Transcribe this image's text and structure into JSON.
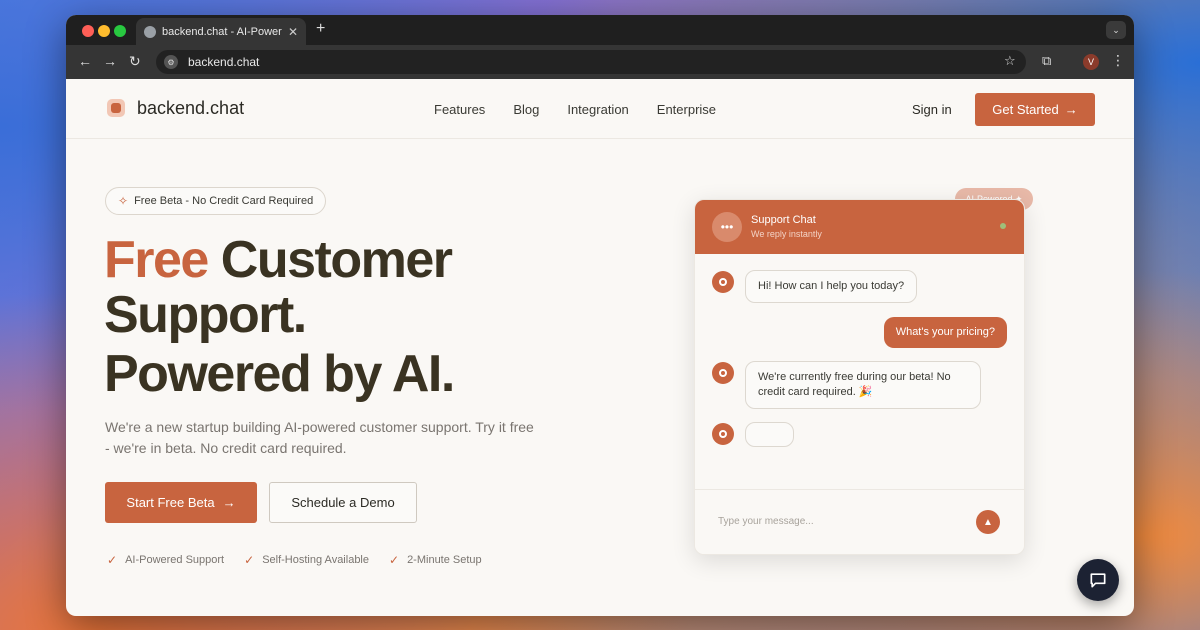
{
  "browser": {
    "tab_title": "backend.chat - AI-Powered C",
    "tab_close": "✕",
    "new_tab": "+",
    "url": "backend.chat",
    "profile_initial": "V"
  },
  "header": {
    "logo_text": "backend.chat",
    "nav": [
      "Features",
      "Blog",
      "Integration",
      "Enterprise"
    ],
    "sign_in": "Sign in",
    "get_started": "Get Started"
  },
  "hero": {
    "badge": "Free Beta - No Credit Card Required",
    "title_accent": "Free",
    "title_line1_rest": " Customer",
    "title_line2": "Support.",
    "title_line3": "Powered by AI.",
    "subtitle": "We're a new startup building AI-powered customer support. Try it free - we're in beta. No credit card required.",
    "primary_cta": "Start Free Beta",
    "secondary_cta": "Schedule a Demo",
    "features": [
      "AI-Powered Support",
      "Self-Hosting Available",
      "2-Minute Setup"
    ]
  },
  "chat": {
    "pill": "AI-Powered ✦",
    "title": "Support Chat",
    "subtitle": "We reply instantly",
    "messages": [
      {
        "from": "bot",
        "text": "Hi! How can I help you today?"
      },
      {
        "from": "user",
        "text": "What's your pricing?"
      },
      {
        "from": "bot",
        "text": "We're currently free during our beta! No credit card required. 🎉"
      },
      {
        "from": "bot",
        "text": ""
      }
    ],
    "input_placeholder": "Type your message..."
  },
  "colors": {
    "accent": "#c8643f",
    "text_dark": "#3a3322",
    "page_bg": "#faf8f5",
    "fab_bg": "#1c2233"
  }
}
